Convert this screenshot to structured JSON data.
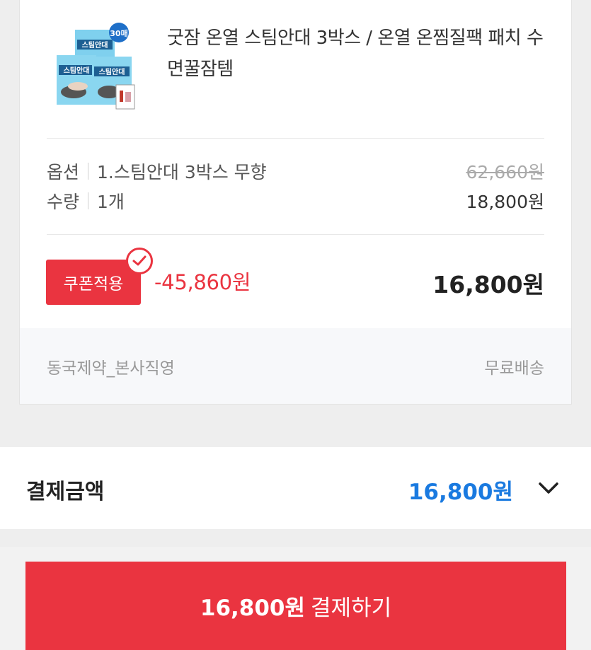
{
  "product": {
    "title": "굿잠 온열 스팀안대 3박스 / 온열 온찜질팩 패치 수면꿀잠템",
    "thumbnail_icon": "product-box-image",
    "thumbnail_badge": "30매",
    "thumbnail_box_text": "스팀안대",
    "option_label": "옵션",
    "option_value": "1.스팀안대 3박스 무향",
    "original_price": "62,660원",
    "quantity_label": "수량",
    "quantity_value": "1개",
    "sale_price": "18,800원"
  },
  "coupon": {
    "badge_label": "쿠폰적용",
    "discount": "-45,860원",
    "final_price": "16,800원",
    "check_icon": "check-circle-icon"
  },
  "seller": {
    "name": "동국제약_본사직영",
    "shipping": "무료배송"
  },
  "payment": {
    "label": "결제금액",
    "amount": "16,800원",
    "chevron_icon": "chevron-down-icon"
  },
  "checkout": {
    "amount": "16,800원",
    "action": "결제하기"
  },
  "colors": {
    "accent_red": "#ea3440",
    "accent_blue": "#1a7ae0"
  }
}
